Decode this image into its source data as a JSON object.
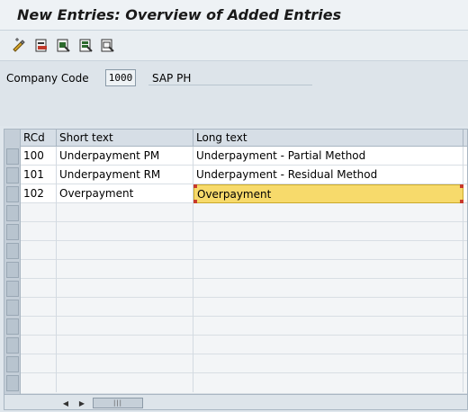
{
  "window": {
    "title": "New Entries: Overview of Added Entries"
  },
  "toolbar": {
    "buttons": [
      {
        "icon": "display-change-icon"
      },
      {
        "icon": "delete-icon"
      },
      {
        "icon": "select-all-icon"
      },
      {
        "icon": "select-block-icon"
      },
      {
        "icon": "deselect-all-icon"
      }
    ]
  },
  "header": {
    "company_code_label": "Company Code",
    "company_code_value": "1000",
    "company_name": "SAP PH"
  },
  "table": {
    "columns": [
      "RCd",
      "Short text",
      "Long text"
    ],
    "rows": [
      {
        "rcd": "100",
        "short_text": "Underpayment PM",
        "long_text": "Underpayment - Partial Method"
      },
      {
        "rcd": "101",
        "short_text": "Underpayment RM",
        "long_text": "Underpayment - Residual Method"
      },
      {
        "rcd": "102",
        "short_text": "Overpayment",
        "long_text": "Overpayment"
      }
    ],
    "active_cell": {
      "row": 2,
      "column": "Long text"
    }
  },
  "colors": {
    "active_cell_bg": "#f7da6b",
    "header_bg": "#d6dee6"
  }
}
